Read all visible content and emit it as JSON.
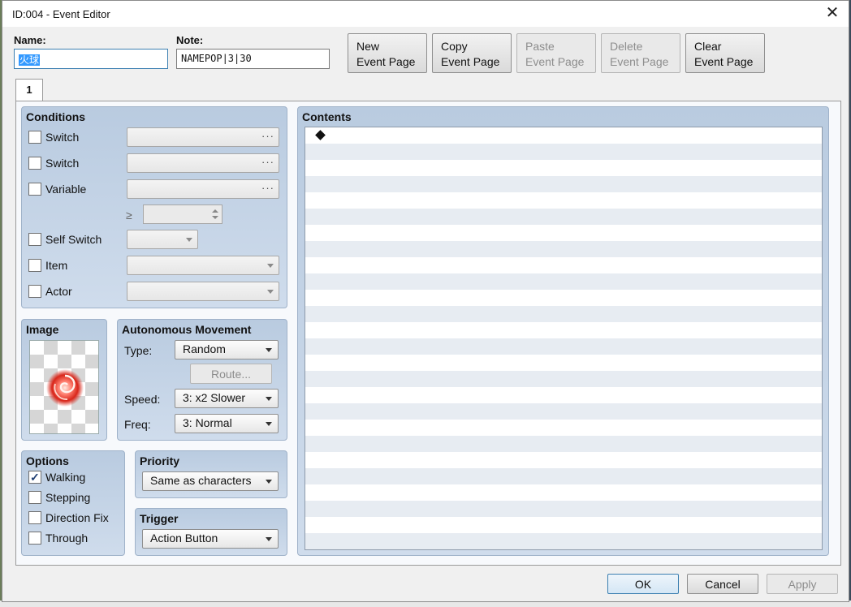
{
  "window": {
    "title": "ID:004 - Event Editor"
  },
  "header": {
    "name_label": "Name:",
    "name_value": "火球",
    "note_label": "Note:",
    "note_value": "NAMEPOP|3|30"
  },
  "toolbar": {
    "new_page": [
      "New",
      "Event Page"
    ],
    "copy_page": [
      "Copy",
      "Event Page"
    ],
    "paste_page": [
      "Paste",
      "Event Page"
    ],
    "delete_page": [
      "Delete",
      "Event Page"
    ],
    "clear_page": [
      "Clear",
      "Event Page"
    ]
  },
  "tabs": [
    {
      "label": "1"
    }
  ],
  "conditions": {
    "title": "Conditions",
    "switch1": "Switch",
    "switch2": "Switch",
    "variable": "Variable",
    "gte": "≥",
    "self_switch": "Self Switch",
    "item": "Item",
    "actor": "Actor"
  },
  "image": {
    "title": "Image"
  },
  "movement": {
    "title": "Autonomous Movement",
    "type_label": "Type:",
    "type_value": "Random",
    "route_button": "Route...",
    "speed_label": "Speed:",
    "speed_value": "3: x2 Slower",
    "freq_label": "Freq:",
    "freq_value": "3: Normal"
  },
  "options": {
    "title": "Options",
    "walking": "Walking",
    "walking_checked": true,
    "stepping": "Stepping",
    "direction_fix": "Direction Fix",
    "through": "Through"
  },
  "priority": {
    "title": "Priority",
    "value": "Same as characters"
  },
  "trigger": {
    "title": "Trigger",
    "value": "Action Button"
  },
  "contents": {
    "title": "Contents"
  },
  "footer": {
    "ok": "OK",
    "cancel": "Cancel",
    "apply": "Apply"
  },
  "colors": {
    "panel": "#c3d3e6",
    "selection": "#3399ff"
  }
}
